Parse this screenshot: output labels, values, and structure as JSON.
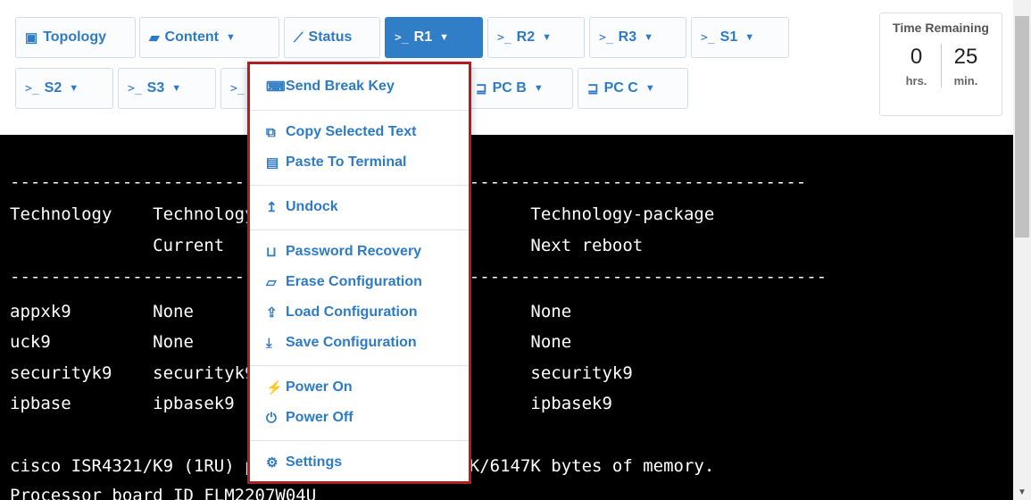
{
  "tabs_row1": [
    {
      "id": "topology",
      "icon": "image-icon",
      "glyph": "🖼",
      "label": "Topology",
      "caret": false
    },
    {
      "id": "content",
      "icon": "book-icon",
      "glyph": "📘",
      "label": "Content",
      "caret": true
    },
    {
      "id": "status",
      "icon": "chart-line-icon",
      "glyph": "📈",
      "label": "Status",
      "caret": false
    },
    {
      "id": "r1",
      "icon": "terminal-icon",
      "glyph": ">_",
      "label": "R1",
      "caret": true,
      "active": true
    },
    {
      "id": "r2",
      "icon": "terminal-icon",
      "glyph": ">_",
      "label": "R2",
      "caret": true
    },
    {
      "id": "r3",
      "icon": "terminal-icon",
      "glyph": ">_",
      "label": "R3",
      "caret": true
    },
    {
      "id": "s1",
      "icon": "terminal-icon",
      "glyph": ">_",
      "label": "S1",
      "caret": true
    }
  ],
  "tabs_row2": [
    {
      "id": "s2",
      "icon": "terminal-icon",
      "glyph": ">_",
      "label": "S2",
      "caret": true
    },
    {
      "id": "s3",
      "icon": "terminal-icon",
      "glyph": ">_",
      "label": "S3",
      "caret": true
    },
    {
      "id": "hidden",
      "icon": "terminal-icon",
      "glyph": ">_",
      "label": "",
      "caret": false
    },
    {
      "id": "pcb",
      "icon": "laptop-icon",
      "glyph": "💻",
      "label": "PC B",
      "caret": true
    },
    {
      "id": "pcc",
      "icon": "laptop-icon",
      "glyph": "💻",
      "label": "PC C",
      "caret": true
    }
  ],
  "timer": {
    "title": "Time Remaining",
    "hours": "0",
    "minutes": "25",
    "hours_unit": "hrs.",
    "minutes_unit": "min."
  },
  "terminal_lines": [
    "------------------------------------------------------------------------------",
    "Technology    Technology-package                   Technology-package",
    "              Current          Type                Next reboot",
    "--------------------------------------------------------------------------------",
    "appxk9        None             None                None",
    "uck9          None             None                None",
    "securityk9    securityk9       Permanent           securityk9",
    "ipbase        ipbasek9         Permanent           ipbasek9",
    "",
    "cisco ISR4321/K9 (1RU) processor with 1648789K/6147K bytes of memory.",
    "Processor board ID FLM2207W04U"
  ],
  "menu": {
    "items": [
      {
        "name": "send-break-key",
        "icon": "keyboard-icon",
        "glyph": "⌨",
        "label": "Send Break Key"
      },
      {
        "name": "copy-selected-text",
        "icon": "copy-icon",
        "glyph": "⧉",
        "label": "Copy Selected Text"
      },
      {
        "name": "paste-to-terminal",
        "icon": "paste-icon",
        "glyph": "📋",
        "label": "Paste To Terminal"
      },
      {
        "name": "undock",
        "icon": "arrow-up-icon",
        "glyph": "↥",
        "label": "Undock"
      },
      {
        "name": "password-recovery",
        "icon": "unlock-icon",
        "glyph": "🔓",
        "label": "Password Recovery"
      },
      {
        "name": "erase-configuration",
        "icon": "eraser-icon",
        "glyph": "⌫",
        "label": "Erase Configuration"
      },
      {
        "name": "load-configuration",
        "icon": "upload-icon",
        "glyph": "⭱",
        "label": "Load Configuration"
      },
      {
        "name": "save-configuration",
        "icon": "download-icon",
        "glyph": "⭳",
        "label": "Save Configuration"
      },
      {
        "name": "power-on",
        "icon": "plug-icon",
        "glyph": "🔌",
        "label": "Power On"
      },
      {
        "name": "power-off",
        "icon": "power-icon",
        "glyph": "⏻",
        "label": "Power Off"
      },
      {
        "name": "settings",
        "icon": "gear-icon",
        "glyph": "⚙",
        "label": "Settings"
      }
    ]
  },
  "colors": {
    "accent": "#2e7bc5",
    "active_tab": "#2f7ec7",
    "menu_border": "#b01e24",
    "terminal_bg": "#000000"
  }
}
